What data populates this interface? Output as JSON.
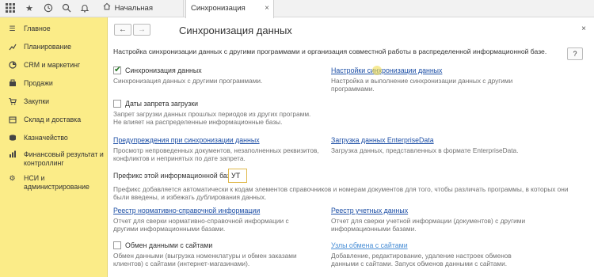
{
  "topbar": {
    "tabs": [
      {
        "label": "Начальная страница"
      },
      {
        "label": "Синхронизация данных",
        "close": "×"
      }
    ]
  },
  "sidebar": {
    "items": [
      {
        "label": "Главное",
        "icon": "menu-icon"
      },
      {
        "label": "Планирование",
        "icon": "planning-icon"
      },
      {
        "label": "CRM и маркетинг",
        "icon": "crm-icon"
      },
      {
        "label": "Продажи",
        "icon": "sales-icon"
      },
      {
        "label": "Закупки",
        "icon": "purchases-icon"
      },
      {
        "label": "Склад и доставка",
        "icon": "warehouse-icon"
      },
      {
        "label": "Казначейство",
        "icon": "treasury-icon"
      },
      {
        "label": "Финансовый результат и",
        "label2": "контроллинг",
        "icon": "finance-icon"
      },
      {
        "label": "НСИ и",
        "label2": "администрирование",
        "icon": "gear-icon"
      }
    ]
  },
  "main": {
    "title": "Синхронизация данных",
    "back": "←",
    "forward": "→",
    "close": "×",
    "help": "?",
    "intro": "Настройка синхронизации данных с другими программами и организация совместной работы в распределенной информационной базе.",
    "sync": {
      "label": "Синхронизация данных",
      "checked": true,
      "desc": "Синхронизация данных с другими программами."
    },
    "sync_settings": {
      "link": "Настройки синхронизации данных",
      "desc1": "Настройка и выполнение синхронизации данных с другими",
      "desc2": "программами."
    },
    "ban_dates": {
      "label": "Даты запрета загрузки",
      "checked": false,
      "desc1": "Запрет загрузки данных прошлых периодов из других программ.",
      "desc2": "Не влияет на распределенные информационные базы."
    },
    "warnings": {
      "link": "Предупреждения при синхронизации данных",
      "desc1": "Просмотр непроведенных документов, незаполненных реквизитов,",
      "desc2": "конфликтов и непринятых по дате запрета."
    },
    "enterprise": {
      "link": "Загрузка данных EnterpriseData",
      "desc": "Загрузка данных, представленных в формате EnterpriseData."
    },
    "prefix": {
      "label": "Префикс этой информационной базы:",
      "value": "УТ",
      "desc1": "Префикс добавляется автоматически к кодам элементов справочников и номерам документов для того, чтобы различать программы, в которых они",
      "desc2": "были введены, и избежать дублирования данных."
    },
    "nsi_registry": {
      "link": "Реестр нормативно-справочной информации",
      "desc1": "Отчет для сверки нормативно-справочной информации с",
      "desc2": "другими информационными базами."
    },
    "accounting_registry": {
      "link": "Реестр учетных данных",
      "desc1": "Отчет для сверки учетной информации (документов) с другими",
      "desc2": "информационными базами."
    },
    "sites": {
      "label": "Обмен данными с сайтами",
      "checked": false,
      "desc1": "Обмен данными (выгрузка номенклатуры и обмен заказами",
      "desc2": "клиентов) с сайтами (интернет-магазинами)."
    },
    "exchange_nodes": {
      "link": "Узлы обмена с сайтами",
      "desc1": "Добавление, редактирование, удаление настроек обменов",
      "desc2": "данными с сайтами. Запуск обменов данными с сайтами."
    }
  }
}
